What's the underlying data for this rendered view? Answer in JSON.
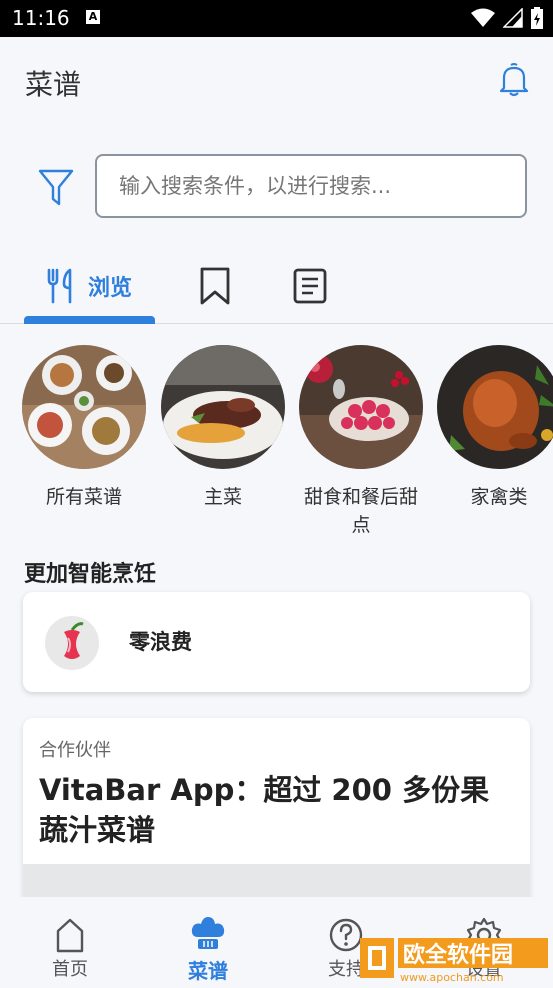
{
  "status_bar": {
    "time": "11:16"
  },
  "header": {
    "title": "菜谱"
  },
  "search": {
    "placeholder": "输入搜索条件，以进行搜索..."
  },
  "tabs": {
    "browse_label": "浏览"
  },
  "categories": [
    {
      "label": "所有菜谱"
    },
    {
      "label": "主菜"
    },
    {
      "label": "甜食和餐后甜点"
    },
    {
      "label": "家禽类"
    }
  ],
  "smarter_section": {
    "title": "更加智能烹饪",
    "card_label": "零浪费"
  },
  "partner": {
    "tag": "合作伙伴",
    "title": "VitaBar App：超过 200 多份果蔬汁菜谱"
  },
  "bottom_nav": {
    "home": "首页",
    "recipes": "菜谱",
    "support": "支持",
    "settings": "设置"
  },
  "watermark": {
    "text": "欧全软件园",
    "url": "www.apochan.com"
  },
  "colors": {
    "accent": "#2f7fdc",
    "background": "#f5f7fb"
  }
}
